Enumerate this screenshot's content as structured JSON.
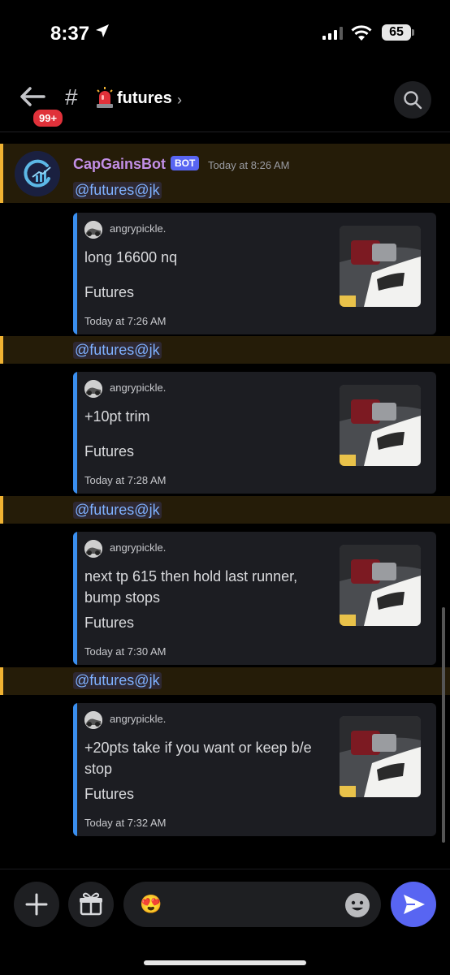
{
  "status_bar": {
    "time": "8:37",
    "battery": "65"
  },
  "header": {
    "unread_badge": "99+",
    "hash": "#",
    "channel_name": "futures"
  },
  "message": {
    "author": "CapGainsBot",
    "bot_tag": "BOT",
    "timestamp": "Today at 8:26 AM"
  },
  "posts": [
    {
      "mention": "@futures@jk",
      "embed_author": "angrypickle.",
      "description": "long 16600 nq",
      "field": "Futures",
      "footer": "Today at 7:26 AM"
    },
    {
      "mention": "@futures@jk",
      "embed_author": "angrypickle.",
      "description": "+10pt trim",
      "field": "Futures",
      "footer": "Today at 7:28 AM"
    },
    {
      "mention": "@futures@jk",
      "embed_author": "angrypickle.",
      "description": "next tp 615 then hold last runner, bump stops",
      "field": "Futures",
      "footer": "Today at 7:30 AM"
    },
    {
      "mention": "@futures@jk",
      "embed_author": "angrypickle.",
      "description": "+20pts take if you want or keep b/e stop",
      "field": "Futures",
      "footer": "Today at 7:32 AM"
    }
  ],
  "composer": {
    "emoji": "😍"
  },
  "colors": {
    "accent": "#5865f2",
    "mention_highlight": "#f0b232",
    "embed_bar": "#3a8ff0",
    "author": "#c28fe6"
  }
}
